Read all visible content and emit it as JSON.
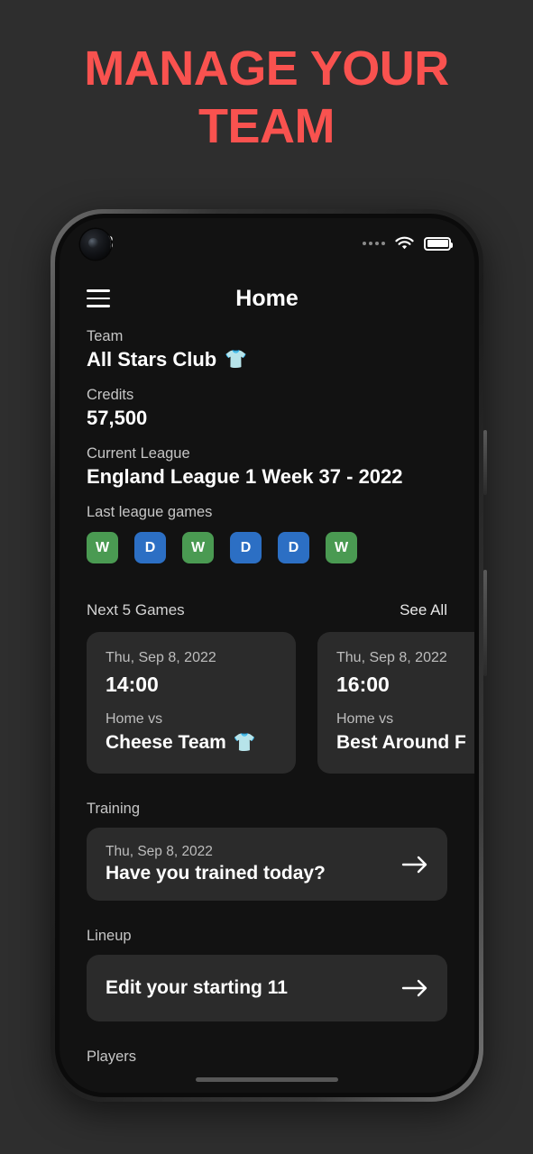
{
  "hero": {
    "line1": "MANAGE YOUR",
    "line2": "TEAM",
    "color": "#f9524f"
  },
  "phone": {
    "statusbar": {
      "time": ".33",
      "signal_icon": "signal-dots-icon",
      "wifi_icon": "wifi-icon",
      "battery_icon": "battery-full-icon"
    },
    "appbar": {
      "menu_icon": "hamburger-menu-icon",
      "title": "Home"
    },
    "team": {
      "label": "Team",
      "name": "All Stars Club",
      "jersey_icon": "jersey-icon",
      "jersey_color": "#1a18ff"
    },
    "credits": {
      "label": "Credits",
      "value": "57,500"
    },
    "league": {
      "label": "Current League",
      "value": "England League 1 Week 37 - 2022"
    },
    "last_games": {
      "label": "Last league games",
      "results": [
        {
          "result": "W",
          "color": "#4a9a52"
        },
        {
          "result": "D",
          "color": "#2c6fc4"
        },
        {
          "result": "W",
          "color": "#4a9a52"
        },
        {
          "result": "D",
          "color": "#2c6fc4"
        },
        {
          "result": "D",
          "color": "#2c6fc4"
        },
        {
          "result": "W",
          "color": "#4a9a52"
        }
      ]
    },
    "next_games": {
      "title": "Next 5 Games",
      "see_all": "See All",
      "cards": [
        {
          "date": "Thu, Sep 8, 2022",
          "time": "14:00",
          "home_away": "Home vs",
          "opponent": "Cheese Team",
          "jersey_icon": "jersey-icon",
          "jersey_color": "#21e321"
        },
        {
          "date": "Thu, Sep 8, 2022",
          "time": "16:00",
          "home_away": "Home vs",
          "opponent": "Best Around F",
          "jersey_icon": "jersey-icon",
          "jersey_color": "#21e321"
        }
      ]
    },
    "training": {
      "label": "Training",
      "date": "Thu, Sep 8, 2022",
      "title": "Have you trained today?",
      "arrow_icon": "arrow-right-icon"
    },
    "lineup": {
      "label": "Lineup",
      "title": "Edit your starting 11",
      "arrow_icon": "arrow-right-icon"
    },
    "players": {
      "label": "Players"
    }
  }
}
